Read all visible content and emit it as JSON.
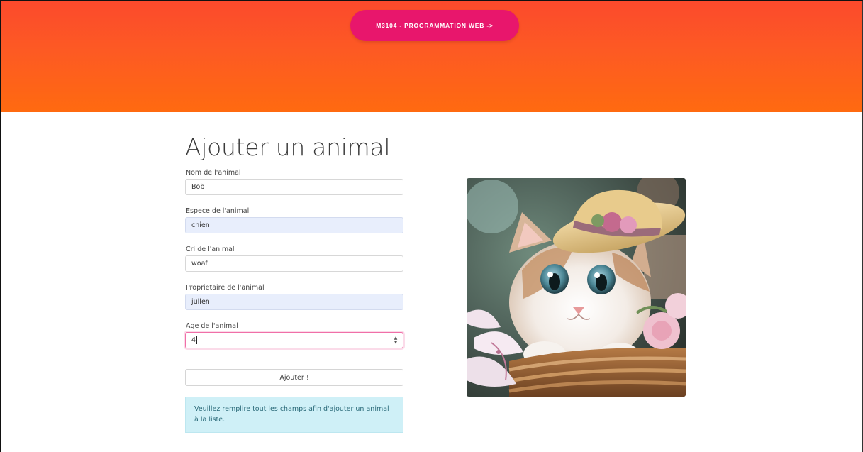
{
  "header": {
    "nav_button_label": "M3104 - PROGRAMMATION WEB ->"
  },
  "page": {
    "title": "Ajouter un animal"
  },
  "form": {
    "fields": [
      {
        "label": "Nom de l'animal",
        "value": "Bob"
      },
      {
        "label": "Espece de l'animal",
        "value": "chien"
      },
      {
        "label": "Cri de l'animal",
        "value": "woaf"
      },
      {
        "label": "Proprietaire de l'animal",
        "value": "jullen"
      },
      {
        "label": "Age de l'animal",
        "value": "4"
      }
    ],
    "submit_label": "Ajouter !",
    "info_message": "Veuillez remplire tout les champs afin d'ajouter un animal à la liste."
  },
  "image": {
    "icon": "kitten-photo"
  },
  "colors": {
    "header_gradient_top": "#fc4a2c",
    "header_gradient_bottom": "#ff6a10",
    "nav_button": "#e8166c",
    "alert_background": "#cff0f7",
    "focus_border": "#f06fa8",
    "autofill_background": "#e8eefc"
  }
}
